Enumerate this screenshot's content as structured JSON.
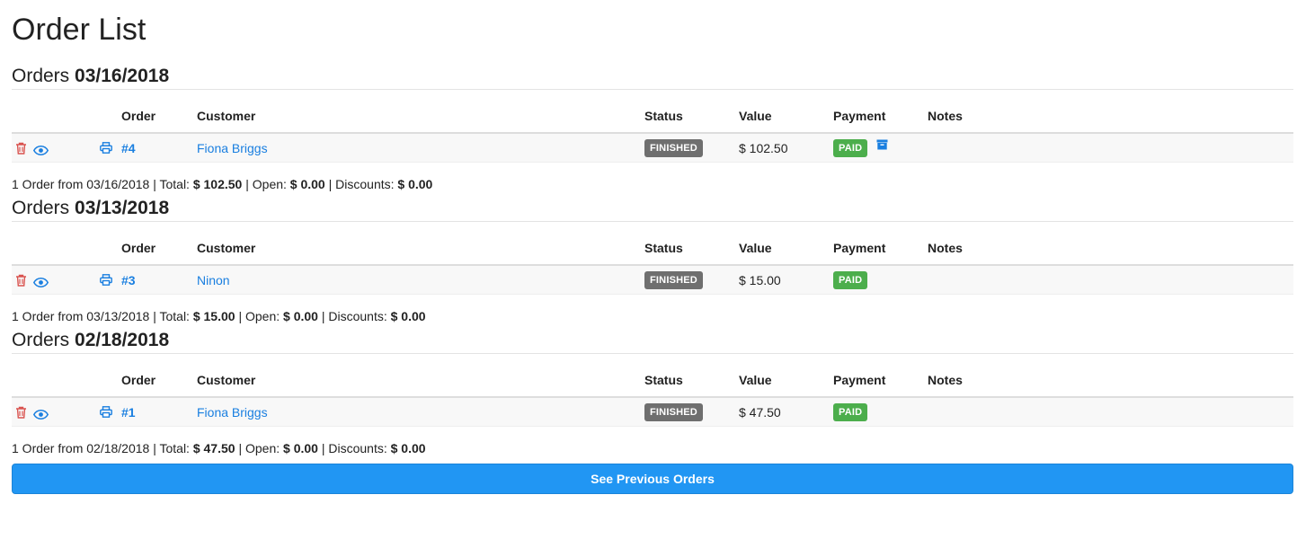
{
  "page": {
    "title": "Order List"
  },
  "table_headers": {
    "order": "Order",
    "customer": "Customer",
    "status": "Status",
    "value": "Value",
    "payment": "Payment",
    "notes": "Notes"
  },
  "sections": [
    {
      "prefix": "Orders",
      "date": "03/16/2018",
      "orders": [
        {
          "number": "#4",
          "customer": "Fiona Briggs",
          "status": "FINISHED",
          "value": "$ 102.50",
          "payment": "PAID",
          "archived": true,
          "notes": ""
        }
      ],
      "summary": {
        "count_text": "1 Order from 03/16/2018",
        "total_label": "Total:",
        "total": "$ 102.50",
        "open_label": "Open:",
        "open": "$ 0.00",
        "discounts_label": "Discounts:",
        "discounts": "$ 0.00"
      }
    },
    {
      "prefix": "Orders",
      "date": "03/13/2018",
      "orders": [
        {
          "number": "#3",
          "customer": "Ninon",
          "status": "FINISHED",
          "value": "$ 15.00",
          "payment": "PAID",
          "archived": false,
          "notes": ""
        }
      ],
      "summary": {
        "count_text": "1 Order from 03/13/2018",
        "total_label": "Total:",
        "total": "$ 15.00",
        "open_label": "Open:",
        "open": "$ 0.00",
        "discounts_label": "Discounts:",
        "discounts": "$ 0.00"
      }
    },
    {
      "prefix": "Orders",
      "date": "02/18/2018",
      "orders": [
        {
          "number": "#1",
          "customer": "Fiona Briggs",
          "status": "FINISHED",
          "value": "$ 47.50",
          "payment": "PAID",
          "archived": false,
          "notes": ""
        }
      ],
      "summary": {
        "count_text": "1 Order from 02/18/2018",
        "total_label": "Total:",
        "total": "$ 47.50",
        "open_label": "Open:",
        "open": "$ 0.00",
        "discounts_label": "Discounts:",
        "discounts": "$ 0.00"
      }
    }
  ],
  "footer": {
    "previous_button_label": "See Previous Orders"
  },
  "icons": {
    "delete": "trash-icon",
    "view": "eye-icon",
    "print": "printer-icon",
    "archive": "archive-icon"
  },
  "colors": {
    "link": "#1a7fe0",
    "danger": "#d9534f",
    "status_badge": "#6f6f6f",
    "paid_badge": "#4cae4c",
    "primary_button": "#2196f3"
  }
}
